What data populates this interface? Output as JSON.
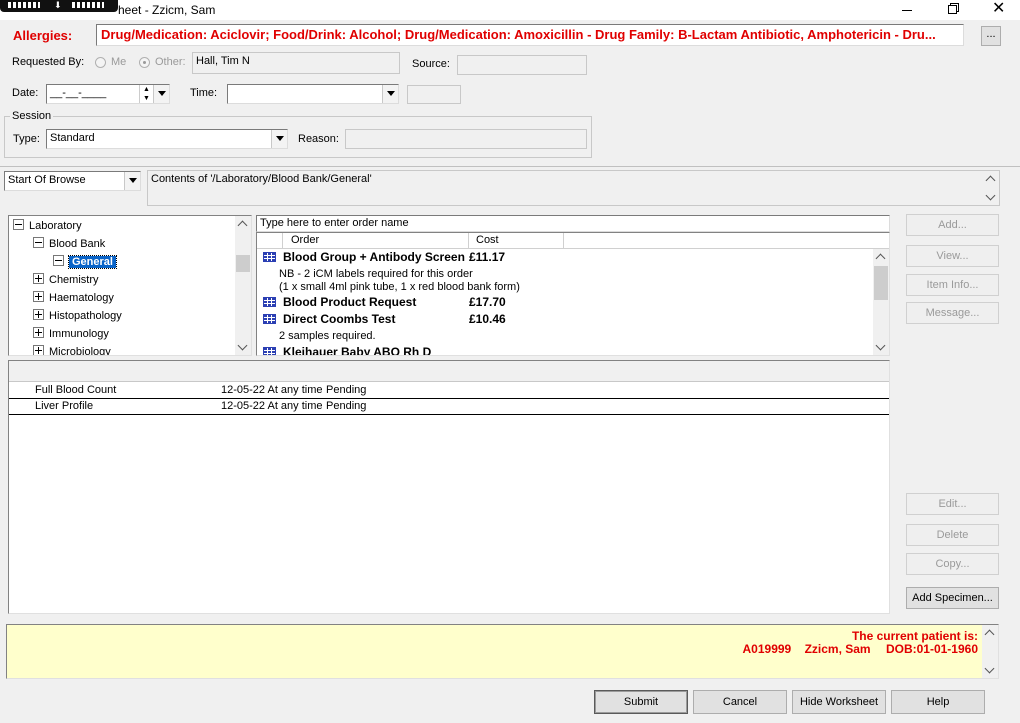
{
  "window": {
    "title": "heet - Zzicm, Sam",
    "min_icon": "minimize-icon",
    "restore_icon": "restore-icon",
    "close_icon": "close-icon"
  },
  "allergies": {
    "label": "Allergies:",
    "text": "Drug/Medication: Aciclovir; Food/Drink: Alcohol; Drug/Medication: Amoxicillin - Drug Family: B-Lactam Antibiotic, Amphotericin - Dru...",
    "more_label": "...",
    "color": "#e00000"
  },
  "requested_by": {
    "label": "Requested By:",
    "me_label": "Me",
    "other_label": "Other:",
    "value": "Hall, Tim N",
    "source_label": "Source:",
    "source_value": ""
  },
  "date": {
    "label": "Date:",
    "value": "__-__-____"
  },
  "time": {
    "label": "Time:",
    "value": ""
  },
  "session": {
    "group_label": "Session",
    "type_label": "Type:",
    "type_value": "Standard",
    "reason_label": "Reason:",
    "reason_value": ""
  },
  "browse": {
    "select_value": "Start Of Browse",
    "contents": "Contents of '/Laboratory/Blood Bank/General'"
  },
  "tree": {
    "items": [
      {
        "label": "Laboratory",
        "state": "expanded"
      },
      {
        "label": "Blood Bank",
        "state": "expanded"
      },
      {
        "label": "General",
        "state": "expanded",
        "selected": true
      },
      {
        "label": "Chemistry",
        "state": "collapsed"
      },
      {
        "label": "Haematology",
        "state": "collapsed"
      },
      {
        "label": "Histopathology",
        "state": "collapsed"
      },
      {
        "label": "Immunology",
        "state": "collapsed"
      },
      {
        "label": "Microbiology",
        "state": "collapsed"
      }
    ]
  },
  "orders": {
    "search_placeholder": "Type here to enter order name",
    "col_order": "Order",
    "col_cost": "Cost",
    "rows": [
      {
        "name": "Blood Group + Antibody Screen",
        "cost": "£11.17",
        "notes": [
          "NB - 2 iCM labels required for this order",
          "(1 x small 4ml pink tube, 1 x red blood bank form)"
        ]
      },
      {
        "name": "Blood Product Request",
        "cost": "£17.70",
        "notes": []
      },
      {
        "name": "Direct Coombs Test",
        "cost": "£10.46",
        "notes": [
          "2 samples required."
        ]
      },
      {
        "name": "Kleihauer Baby ABO Rh D",
        "cost": "",
        "notes": []
      }
    ]
  },
  "side_buttons": {
    "add": "Add...",
    "view": "View...",
    "item_info": "Item Info...",
    "message": "Message...",
    "edit": "Edit...",
    "delete": "Delete",
    "copy": "Copy...",
    "add_specimen": "Add Specimen..."
  },
  "worksheet": {
    "rows": [
      {
        "name": "Full Blood Count",
        "when": "12-05-22 At any time",
        "status": "Pending"
      },
      {
        "name": "Liver Profile",
        "when": "12-05-22 At any time",
        "status": "Pending"
      }
    ]
  },
  "patient": {
    "heading": "The current patient is:",
    "id": "A019999",
    "name": "Zzicm, Sam",
    "dob": "DOB:01-01-1960",
    "color": "#e00000",
    "bg": "#ffffcc"
  },
  "footer": {
    "submit": "Submit",
    "cancel": "Cancel",
    "hide_worksheet": "Hide Worksheet",
    "help": "Help"
  }
}
